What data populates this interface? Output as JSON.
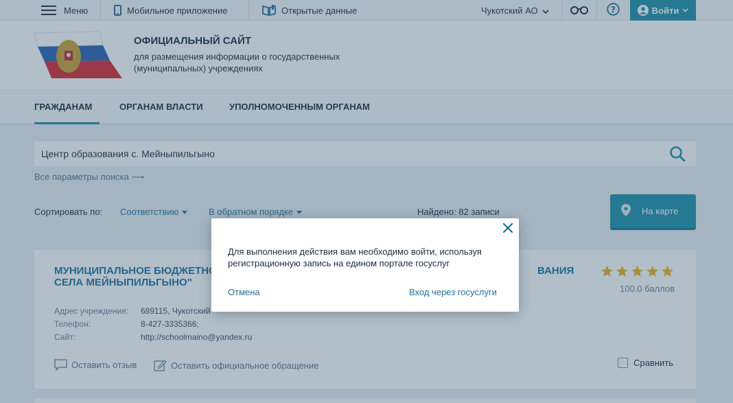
{
  "topbar": {
    "menu_label": "Меню",
    "mobile_label": "Мобильное приложение",
    "opendata_label": "Открытые данные",
    "region_label": "Чукотский АО",
    "login_label": "Войти"
  },
  "header": {
    "title": "ОФИЦИАЛЬНЫЙ САЙТ",
    "subtitle_line1": "для размещения информации о государственных",
    "subtitle_line2": "(муниципальных) учреждениях"
  },
  "nav": {
    "items": [
      {
        "label": "ГРАЖДАНАМ",
        "active": true
      },
      {
        "label": "ОРГАНАМ ВЛАСТИ",
        "active": false
      },
      {
        "label": "УПОЛНОМОЧЕННЫМ ОРГАНАМ",
        "active": false
      }
    ]
  },
  "search": {
    "value": "Центр образования с. Мейныпильгыно",
    "advanced_label": "Все параметры поиска ⟶"
  },
  "sort": {
    "label": "Сортировать по:",
    "by": "Соответствию",
    "order": "В обратном порядке",
    "found": "Найдено: 82 записи",
    "map_button": "На карте"
  },
  "result": {
    "title_line1": "МУНИЦИПАЛЬНОЕ БЮДЖЕТНО",
    "title_line2": "СЕЛА МЕЙНЫПИЛЬГЫНО\"",
    "title_tail": "ВАНИЯ",
    "rating": 5,
    "score": "100.0 баллов",
    "address_label": "Адрес учреждения:",
    "address_value": "689115, Чукотский",
    "phone_label": "Телефон:",
    "phone_value": "8-427-3335366;",
    "site_label": "Сайт:",
    "site_value": "http://schoolmaino@yandex.ru",
    "review_label": "Оставить отзыв",
    "appeal_label": "Оставить официальное обращение",
    "compare_label": "Сравнить"
  },
  "modal": {
    "message": "Для выполнения действия вам необходимо войти, используя регистрационную запись на едином портале госуслуг",
    "cancel_label": "Отмена",
    "login_label": "Вход через госуслуги"
  },
  "colors": {
    "accent": "#1c8fa6",
    "link": "#1f6f9a",
    "star": "#f2b01e"
  }
}
